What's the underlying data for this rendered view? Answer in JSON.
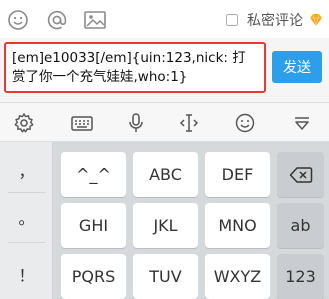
{
  "topbar": {
    "icons": [
      "emoji-icon",
      "at-icon",
      "image-icon"
    ],
    "privacy_label": "私密评论",
    "privacy_checked": false
  },
  "composer": {
    "input_value": "[em]e10033[/em]{uin:123,nick: 打赏了你一个充气娃娃,who:1}",
    "send_label": "发送"
  },
  "keyboard_toolbar": {
    "icons": [
      "settings-icon",
      "keyboard-icon",
      "mic-icon",
      "cursor-icon",
      "emoji-icon",
      "collapse-icon"
    ]
  },
  "keyboard": {
    "symbols": [
      "，",
      "。",
      "！"
    ],
    "row1": [
      "^_^",
      "ABC",
      "DEF"
    ],
    "row2": [
      "GHI",
      "JKL",
      "MNO",
      "ab"
    ],
    "row3": [
      "PQRS",
      "TUV",
      "WXYZ",
      "123"
    ]
  },
  "colors": {
    "accent": "#2d9ee9",
    "highlight_border": "#e53935"
  }
}
